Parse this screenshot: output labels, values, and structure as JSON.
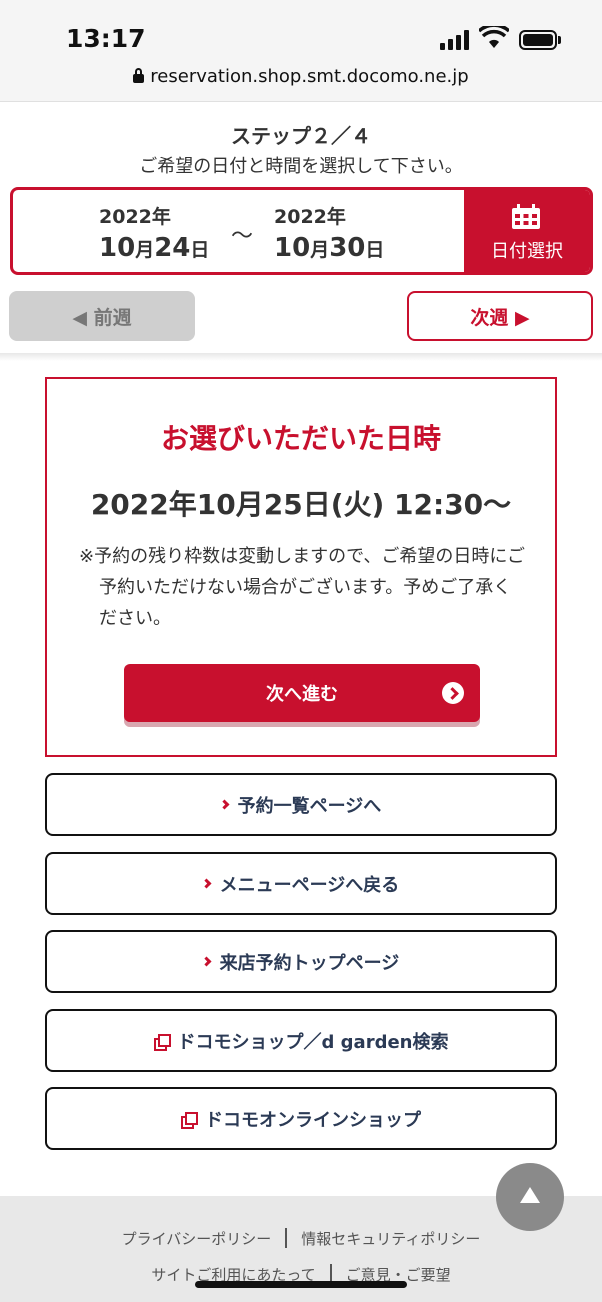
{
  "statusbar": {
    "time": "13:17",
    "url": "reservation.shop.smt.docomo.ne.jp"
  },
  "step": {
    "title": "ステップ２／４",
    "subtitle": "ご希望の日付と時間を選択して下さい。"
  },
  "date_range": {
    "start_year": "2022年",
    "start_month": "10",
    "start_month_unit": "月",
    "start_day": "24",
    "start_day_unit": "日",
    "tilde": "〜",
    "end_year": "2022年",
    "end_month": "10",
    "end_month_unit": "月",
    "end_day": "30",
    "end_day_unit": "日",
    "select_label": "日付選択"
  },
  "week_nav": {
    "prev_label": "◀ 前週",
    "next_label": "次週 ▶"
  },
  "selection": {
    "heading": "お選びいただいた日時",
    "datetime": "2022年10月25日(火) 12:30〜",
    "note": "※予約の残り枠数は変動しますので、ご希望の日時にご予約いただけない場合がございます。予めご了承ください。",
    "proceed_label": "次へ進む"
  },
  "links": [
    {
      "label": "予約一覧ページへ",
      "icon": "chevron-right-icon"
    },
    {
      "label": "メニューページへ戻る",
      "icon": "chevron-right-icon"
    },
    {
      "label": "来店予約トップページ",
      "icon": "chevron-right-icon"
    },
    {
      "label": "ドコモショップ／d garden検索",
      "icon": "external-link-icon"
    },
    {
      "label": "ドコモオンラインショップ",
      "icon": "external-link-icon"
    }
  ],
  "footer": {
    "links": [
      "プライバシーポリシー",
      "情報セキュリティポリシー",
      "サイトご利用にあたって",
      "ご意見・ご要望"
    ]
  },
  "colors": {
    "accent": "#c8102e",
    "link_text": "#2b3a55"
  }
}
